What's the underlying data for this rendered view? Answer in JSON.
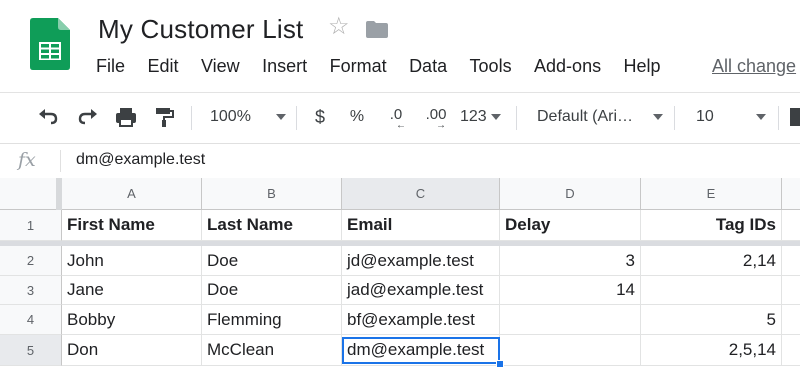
{
  "doc": {
    "title": "My Customer List"
  },
  "menu": [
    "File",
    "Edit",
    "View",
    "Insert",
    "Format",
    "Data",
    "Tools",
    "Add-ons",
    "Help"
  ],
  "menu_link": "All change",
  "toolbar": {
    "zoom": "100%",
    "currency": "$",
    "percent": "%",
    "dec_less": ".0",
    "dec_more": ".00",
    "number_format": "123",
    "font": "Default (Ari…",
    "font_size": "10"
  },
  "formula": {
    "fx": "fx",
    "value": "dm@example.test"
  },
  "columns": [
    "A",
    "B",
    "C",
    "D",
    "E"
  ],
  "rows": [
    "1",
    "2",
    "3",
    "4",
    "5"
  ],
  "header_row": [
    "First Name",
    "Last Name",
    "Email",
    "Delay",
    "Tag IDs"
  ],
  "data_rows": [
    [
      "John",
      "Doe",
      "jd@example.test",
      "3",
      "2,14"
    ],
    [
      "Jane",
      "Doe",
      "jad@example.test",
      "14",
      ""
    ],
    [
      "Bobby",
      "Flemming",
      "bf@example.test",
      "",
      "5"
    ],
    [
      "Don",
      "McClean",
      "dm@example.test",
      "",
      "2,5,14"
    ]
  ],
  "selected_cell": "C5",
  "colors": {
    "sheets_green": "#0f9d58",
    "selection": "#1a73e8"
  }
}
